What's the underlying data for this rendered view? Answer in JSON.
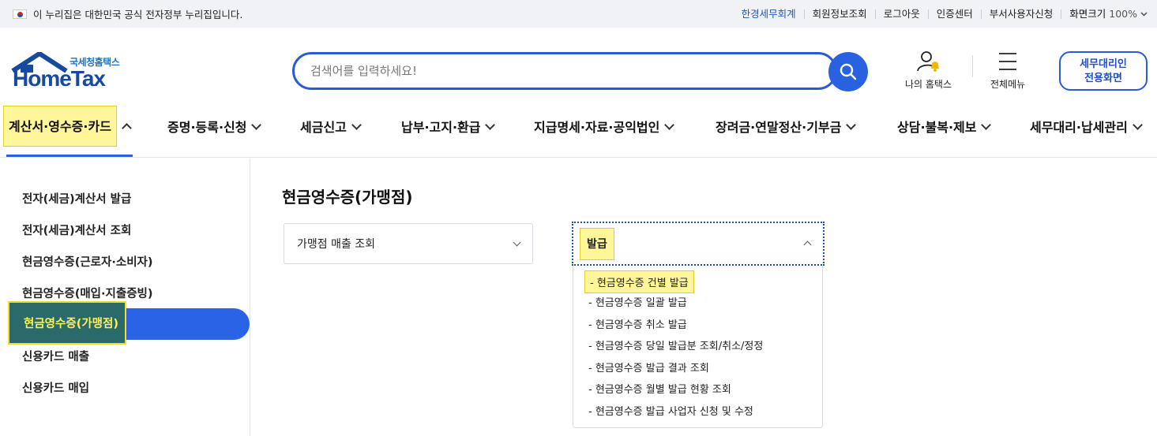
{
  "govbar": {
    "notice": "이 누리집은 대한민국 공식 전자정부 누리집입니다.",
    "links": [
      "한경세무회계",
      "회원정보조회",
      "로그아웃",
      "인증센터",
      "부서사용자신청"
    ],
    "zoom_label": "화면크기",
    "zoom_value": "100%"
  },
  "header": {
    "logo_sub": "국세청홈택스",
    "logo_main": "HomeTax",
    "search_placeholder": "검색어를 입력하세요!",
    "my_hometax": "나의 홈택스",
    "all_menu": "전체메뉴",
    "agent_line1": "세무대리인",
    "agent_line2": "전용화면"
  },
  "gnb": {
    "items": [
      "계산서·영수증·카드",
      "증명·등록·신청",
      "세금신고",
      "납부·고지·환급",
      "지급명세·자료·공익법인",
      "장려금·연말정산·기부금",
      "상담·불복·제보",
      "세무대리·납세관리"
    ]
  },
  "lnb": {
    "items": [
      "전자(세금)계산서 발급",
      "전자(세금)계산서 조회",
      "현금영수증(근로자·소비자)",
      "현금영수증(매입·지출증빙)",
      "현금영수증(가맹점)",
      "신용카드 매출",
      "신용카드 매입"
    ]
  },
  "content": {
    "title": "현금영수증(가맹점)",
    "select1": "가맹점 매출 조회",
    "select2": "발급",
    "options": [
      "현금영수증 건별 발급",
      "현금영수증 일괄 발급",
      "현금영수증 취소 발급",
      "현금영수증 당일 발급분 조회/취소/정정",
      "현금영수증 발급 결과 조회",
      "현금영수증 월별 발급 현황 조회",
      "현금영수증 발급 사업자 신청 및 수정"
    ]
  }
}
